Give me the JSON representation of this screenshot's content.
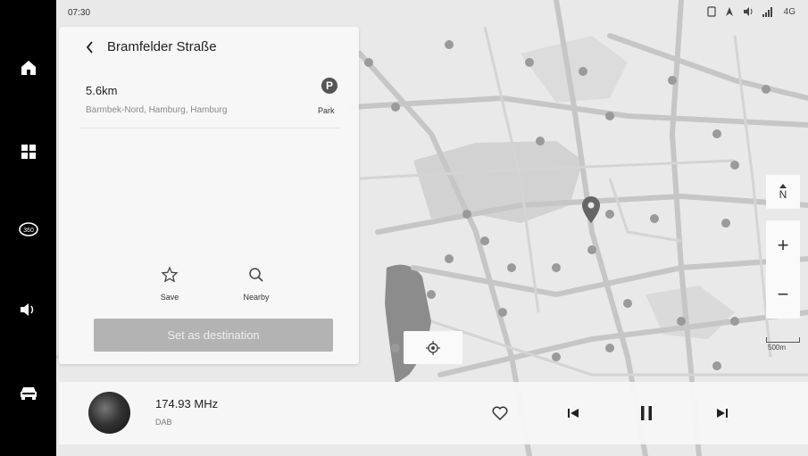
{
  "status": {
    "time": "07:30",
    "network": "4G"
  },
  "rail": {
    "items": [
      {
        "name": "home",
        "icon": "home-icon"
      },
      {
        "name": "apps",
        "icon": "apps-grid-icon"
      },
      {
        "name": "camera-360",
        "icon": "camera-360-icon",
        "label": "360"
      },
      {
        "name": "volume",
        "icon": "volume-icon"
      },
      {
        "name": "vehicle",
        "icon": "car-icon"
      }
    ]
  },
  "card": {
    "title": "Bramfelder Straße",
    "distance": "5.6km",
    "address": "Barmbek-Nord, Hamburg, Hamburg",
    "category_icon": "P",
    "category_label": "Park",
    "actions": [
      {
        "label": "Save",
        "icon": "star-icon"
      },
      {
        "label": "Nearby",
        "icon": "search-icon"
      }
    ],
    "destination_button": "Set as destination"
  },
  "map": {
    "compass_label": "N",
    "zoom_in": "+",
    "zoom_out": "−",
    "scale_label": "500m"
  },
  "media": {
    "frequency": "174.93 MHz",
    "source": "DAB"
  },
  "colors": {
    "rail_bg": "#000000",
    "map_bg": "#e9e9e9",
    "road": "#c9c9c9",
    "green_area": "#cfcfcf",
    "water": "#8c8c8c",
    "button_disabled": "#b3b3b3"
  }
}
